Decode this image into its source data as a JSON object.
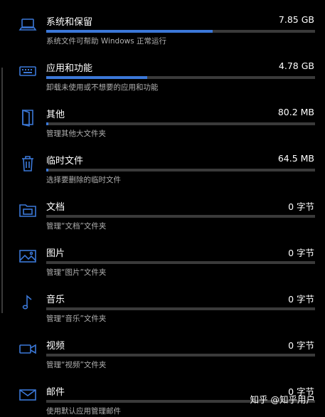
{
  "accent_color": "#3b78d8",
  "items": [
    {
      "icon": "laptop-icon",
      "name": "系统和保留",
      "size": "7.85 GB",
      "desc": "系统文件可帮助 Windows 正常运行",
      "fraction": 0.62
    },
    {
      "icon": "keyboard-icon",
      "name": "应用和功能",
      "size": "4.78 GB",
      "desc": "卸载未使用或不想要的应用和功能",
      "fraction": 0.375
    },
    {
      "icon": "door-icon",
      "name": "其他",
      "size": "80.2 MB",
      "desc": "管理其他大文件夹",
      "fraction": 0.006
    },
    {
      "icon": "trash-icon",
      "name": "临时文件",
      "size": "64.5 MB",
      "desc": "选择要删除的临时文件",
      "fraction": 0.005
    },
    {
      "icon": "folder-icon",
      "name": "文档",
      "size": "0 字节",
      "desc": "管理“文档”文件夹",
      "fraction": 0
    },
    {
      "icon": "picture-icon",
      "name": "图片",
      "size": "0 字节",
      "desc": "管理“图片”文件夹",
      "fraction": 0
    },
    {
      "icon": "music-note-icon",
      "name": "音乐",
      "size": "0 字节",
      "desc": "管理“音乐”文件夹",
      "fraction": 0
    },
    {
      "icon": "video-camera-icon",
      "name": "视频",
      "size": "0 字节",
      "desc": "管理“视频”文件夹",
      "fraction": 0
    },
    {
      "icon": "mail-icon",
      "name": "邮件",
      "size": "0 字节",
      "desc": "使用默认应用管理邮件",
      "fraction": 0
    }
  ],
  "watermark": "知乎 @知乎用户"
}
